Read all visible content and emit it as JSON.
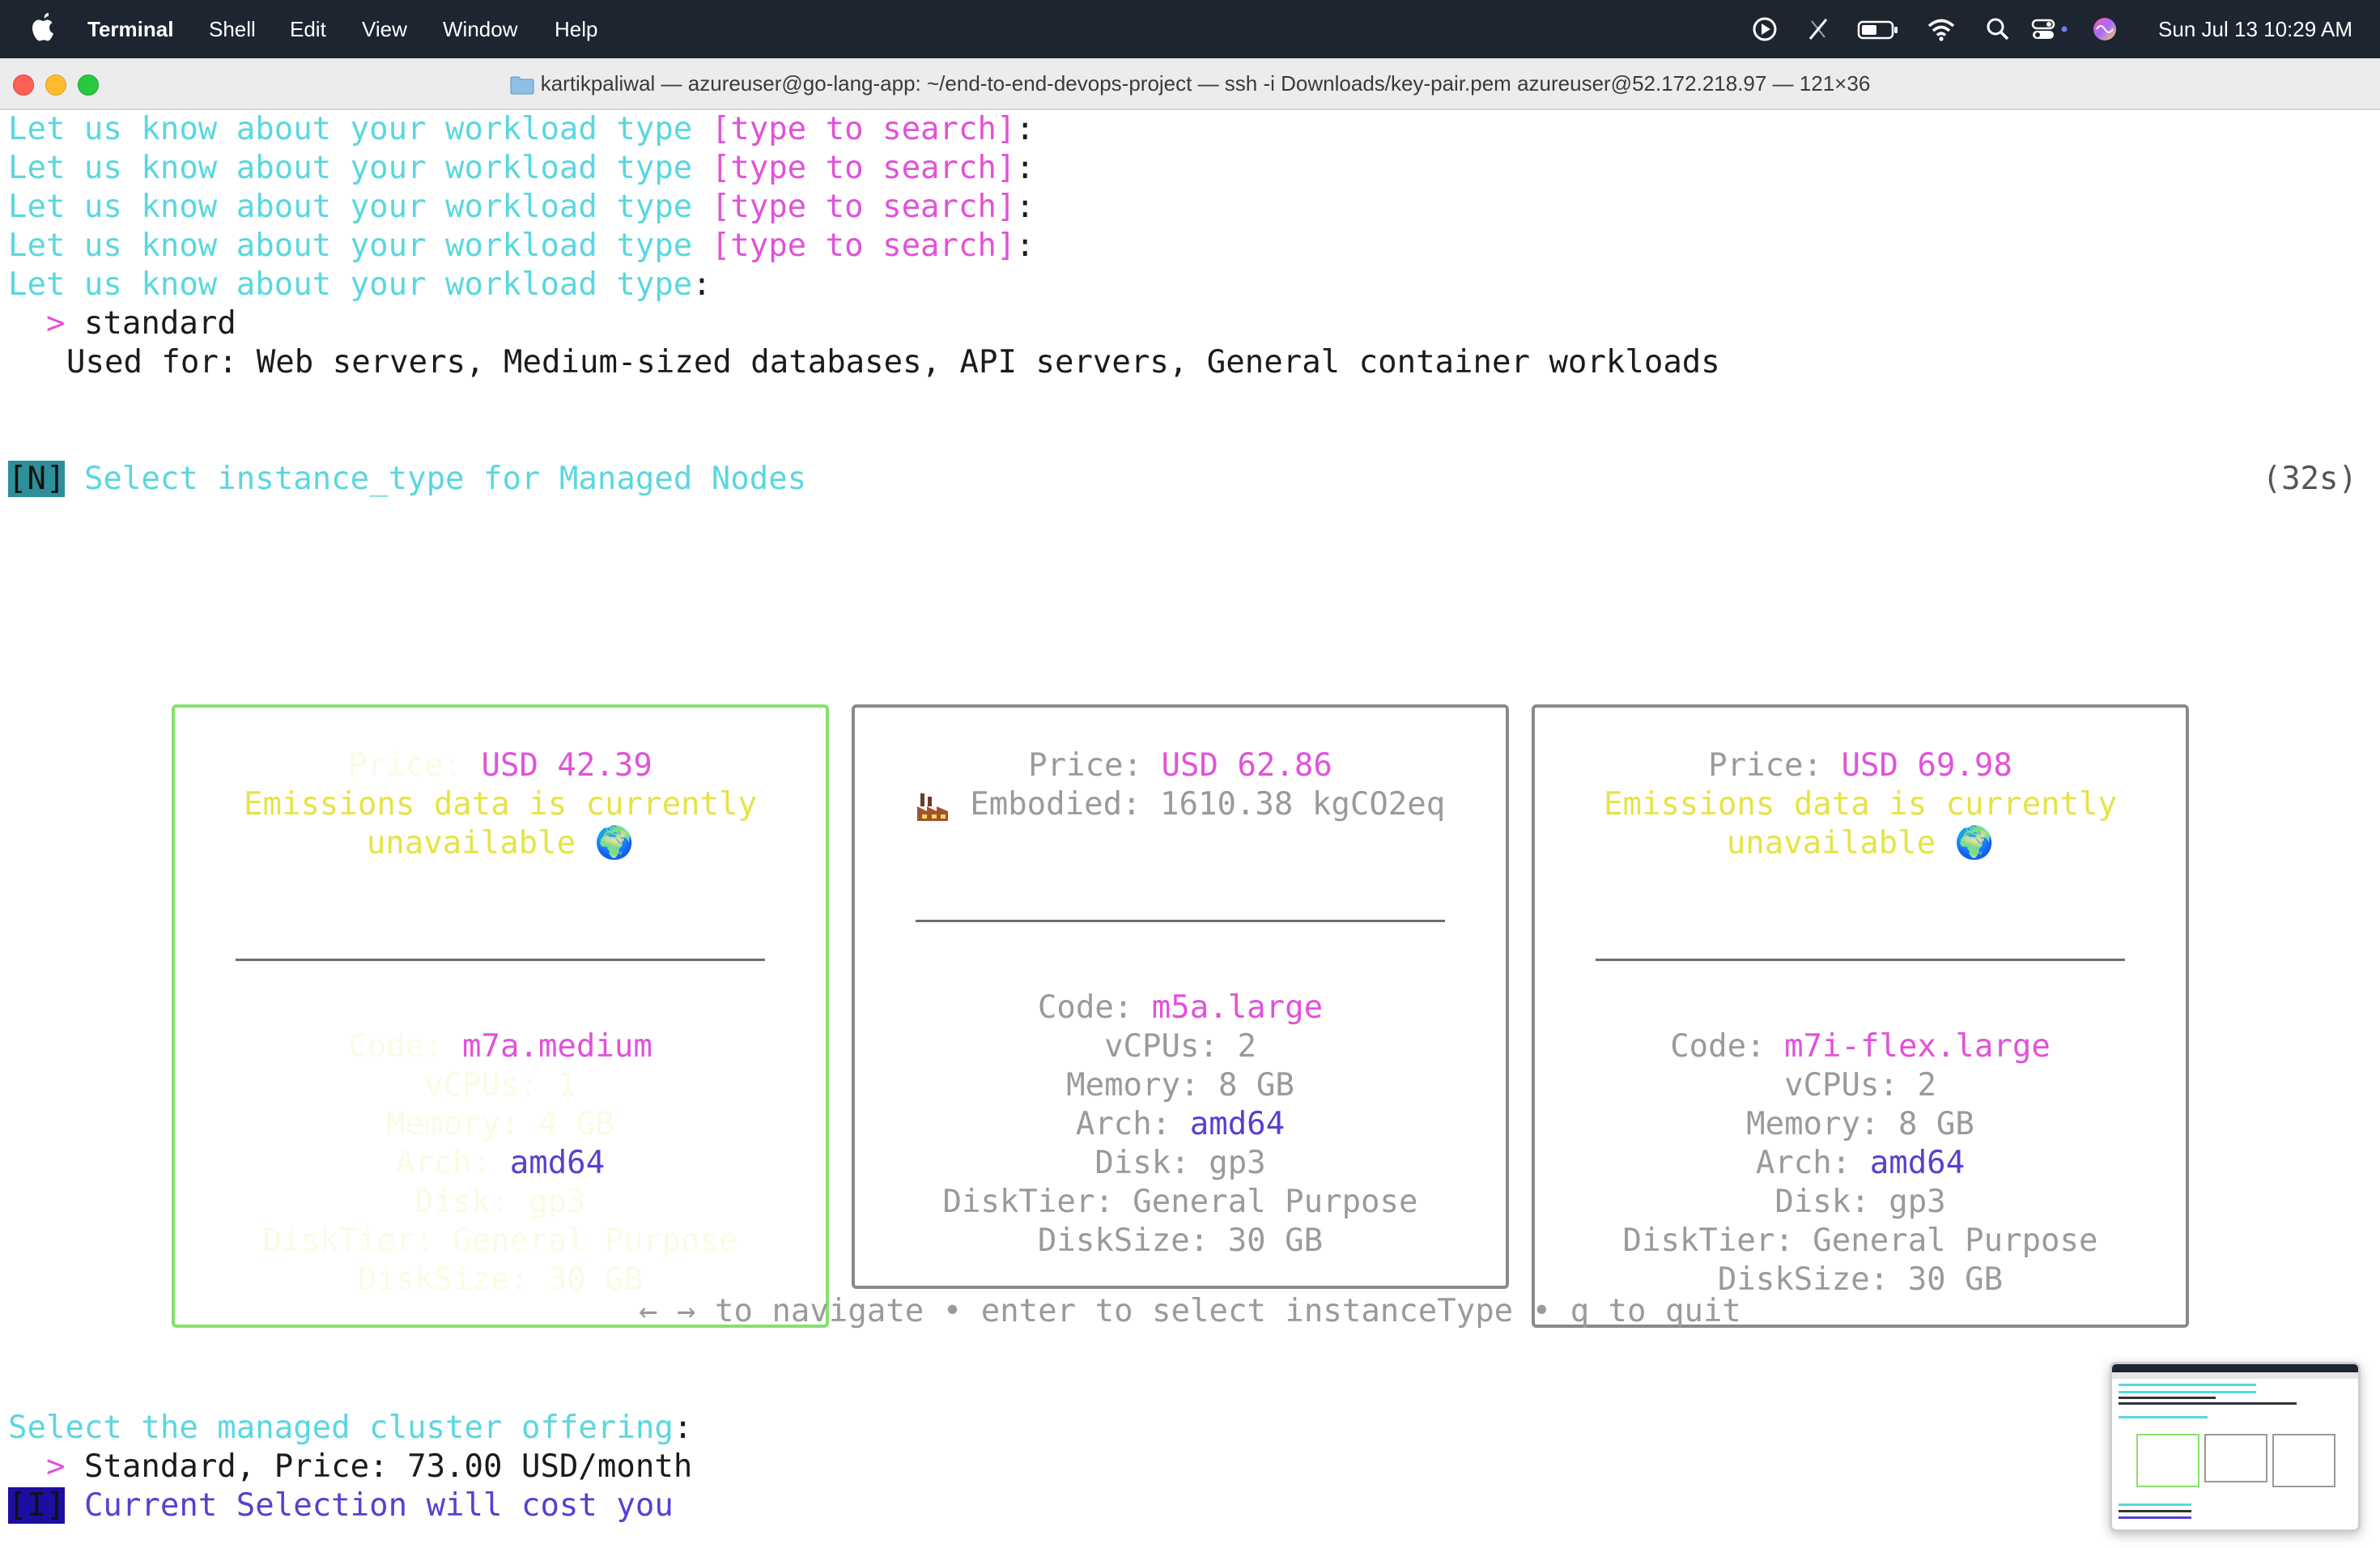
{
  "menubar": {
    "app_name": "Terminal",
    "items": [
      "Shell",
      "Edit",
      "View",
      "Window",
      "Help"
    ],
    "clock": "Sun Jul 13  10:29 AM",
    "status_icons": [
      "play-circle-icon",
      "stylus-off-icon",
      "battery-icon",
      "wifi-icon",
      "search-icon",
      "control-center-icon",
      "siri-icon"
    ]
  },
  "window": {
    "title": "kartikpaliwal — azureuser@go-lang-app: ~/end-to-end-devops-project — ssh -i Downloads/key-pair.pem azureuser@52.172.218.97 — 121×36"
  },
  "terminal": {
    "prompt_prefix": "Let us know about your workload type",
    "search_hint": "[type to search]",
    "colon": ":",
    "cursor_symbol": ">",
    "selected_workload": "standard",
    "used_for": "Used for: Web servers, Medium-sized databases, API servers, General container workloads",
    "badge_n": "[N]",
    "select_prompt": "Select instance_type for Managed Nodes",
    "timer": "(32s)",
    "help": "← → to navigate • enter to select instanceType • q to quit",
    "cluster_prompt": "Select the managed cluster offering",
    "cluster_choice": "Standard, Price: 73.00 USD/month",
    "badge_i": "[I]",
    "cost_text": "Current Selection will cost you"
  },
  "cards": [
    {
      "price_label": "Price:",
      "price": "USD 42.39",
      "emissions": [
        "Emissions data is currently",
        "unavailable"
      ],
      "emoji": "🌍",
      "code_label": "Code:",
      "code": "m7a.medium",
      "vcpus": "vCPUs: 1",
      "memory": "Memory: 4 GB",
      "arch_label": "Arch:",
      "arch": "amd64",
      "disk": "Disk: gp3",
      "disktier": "DiskTier: General Purpose",
      "disksize": "DiskSize: 30 GB"
    },
    {
      "price_label": "Price:",
      "price": "USD 62.86",
      "embodied_icon": "factory-icon",
      "embodied": "Embodied: 1610.38 kgCO2eq",
      "code_label": "Code:",
      "code": "m5a.large",
      "vcpus": "vCPUs: 2",
      "memory": "Memory: 8 GB",
      "arch_label": "Arch:",
      "arch": "amd64",
      "disk": "Disk: gp3",
      "disktier": "DiskTier: General Purpose",
      "disksize": "DiskSize: 30 GB"
    },
    {
      "price_label": "Price:",
      "price": "USD 69.98",
      "emissions": [
        "Emissions data is currently",
        "unavailable"
      ],
      "emoji": "🌍",
      "code_label": "Code:",
      "code": "m7i-flex.large",
      "vcpus": "vCPUs: 2",
      "memory": "Memory: 8 GB",
      "arch_label": "Arch:",
      "arch": "amd64",
      "disk": "Disk: gp3",
      "disktier": "DiskTier: General Purpose",
      "disksize": "DiskSize: 30 GB"
    }
  ],
  "colors": {
    "cyan": "#5ad7df",
    "magenta": "#e152d9",
    "yellow": "#e6e345",
    "purple": "#5b3ed1",
    "selected_border": "#86e06d",
    "menubar": "#1d2530"
  }
}
